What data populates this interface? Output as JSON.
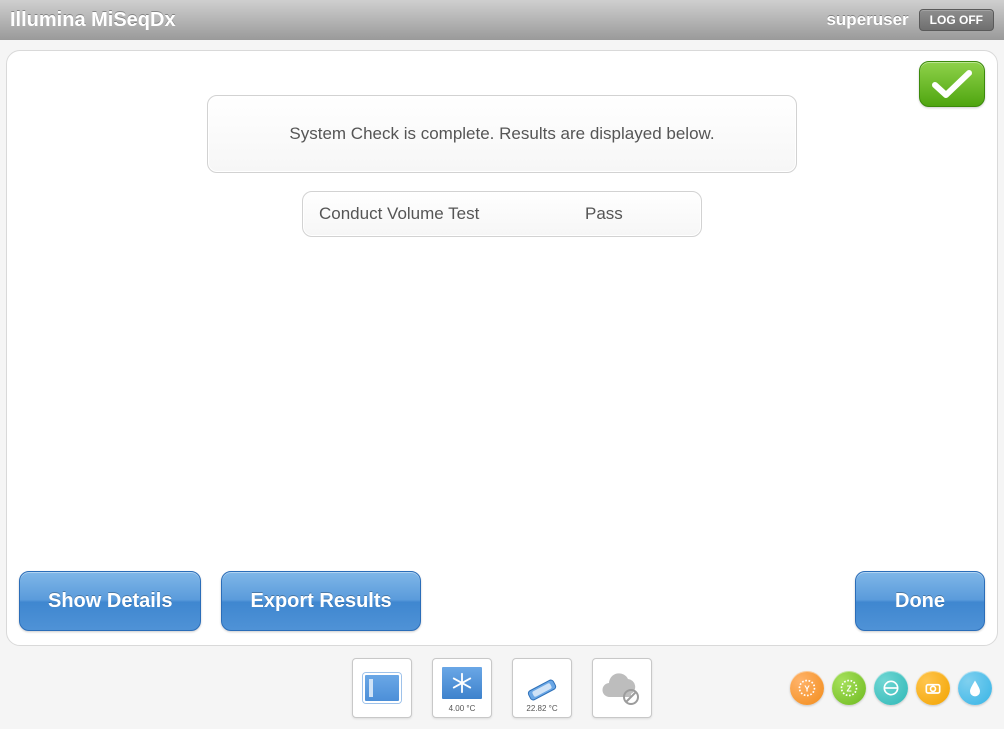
{
  "header": {
    "title": "Illumina MiSeqDx",
    "user": "superuser",
    "logoff": "LOG OFF"
  },
  "status": {
    "overall": "pass"
  },
  "message": "System Check is complete. Results are displayed below.",
  "results": [
    {
      "name": "Conduct Volume Test",
      "status": "Pass"
    }
  ],
  "buttons": {
    "show_details": "Show Details",
    "export_results": "Export Results",
    "done": "Done"
  },
  "footer": {
    "sensors": {
      "flowcell": {
        "label": ""
      },
      "chiller": {
        "label": "4.00 °C"
      },
      "fc_temp": {
        "label": "22.82 °C"
      },
      "cloud": {
        "label": ""
      }
    },
    "icons": {
      "y_stage": "Y",
      "z_stage": "Z",
      "optics": "optics",
      "camera": "camera",
      "fluidics": "fluidics"
    }
  }
}
